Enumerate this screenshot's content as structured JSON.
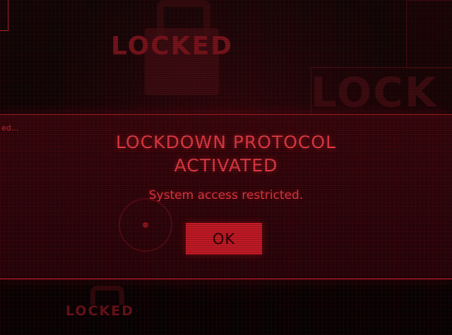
{
  "background": {
    "watermark_words": [
      "LOCKED",
      "LOCK",
      "LOCKED"
    ]
  },
  "dialog": {
    "fragment_text": "ed...",
    "title_line1": "LOCKDOWN PROTOCOL",
    "title_line2": "ACTIVATED",
    "message": "System access restricted.",
    "ok_label": "OK"
  },
  "colors": {
    "accent": "#e23a44",
    "button": "#c41a25",
    "background": "#0b0405"
  }
}
